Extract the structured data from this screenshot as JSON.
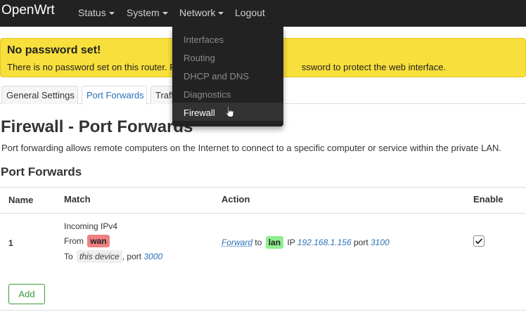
{
  "header": {
    "brand": "OpenWrt",
    "nav": [
      "Status",
      "System",
      "Network",
      "Logout"
    ]
  },
  "network_menu": {
    "items": [
      "Interfaces",
      "Routing",
      "DHCP and DNS",
      "Diagnostics",
      "Firewall"
    ],
    "active": "Firewall"
  },
  "alert": {
    "title": "No password set!",
    "text": "There is no password set on this router. P",
    "text_tail": "ssword to protect the web interface."
  },
  "tabs": [
    "General Settings",
    "Port Forwards",
    "Traffic Rules"
  ],
  "active_tab": "Port Forwards",
  "page": {
    "title": "Firewall - Port Forwards",
    "description": "Port forwarding allows remote computers on the Internet to connect to a specific computer or service within the private LAN.",
    "section_title": "Port Forwards"
  },
  "table": {
    "columns": [
      "Name",
      "Match",
      "Action",
      "Enable"
    ],
    "rows": [
      {
        "name": "1",
        "match_line1": "Incoming IPv4",
        "from_label": "From",
        "from_zone": "wan",
        "to_label": "To",
        "to_device": "this device",
        "port_label": ", port",
        "port": "3000",
        "action_verb": "Forward",
        "to_word": "to",
        "dest_zone": "lan",
        "ip_label": "IP",
        "ip": "192.168.1.156",
        "dest_port_label": "port",
        "dest_port": "3100",
        "enabled": true
      }
    ]
  },
  "add_label": "Add",
  "colors": {
    "navbar": "#222222",
    "alert": "#f8df3c",
    "link": "#2a70b8",
    "zone_wan": "#f08080",
    "zone_lan": "#90ee90",
    "add_button": "#3a9a3a"
  }
}
